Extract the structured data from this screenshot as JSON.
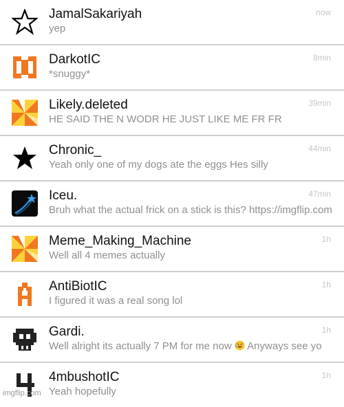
{
  "conversations": [
    {
      "name": "JamalSakariyah",
      "message": "yep",
      "time": "now",
      "avatar_icon": "star-outline-icon"
    },
    {
      "name": "DarkotIC",
      "message": "*snuggy*",
      "time": "8min",
      "avatar_icon": "orange-block-logo-icon",
      "avatar_color": "#f07820"
    },
    {
      "name": "Likely.deleted",
      "message": "HE SAID THE N WODR HE JUST LIKE ME FR FR",
      "time": "39min",
      "avatar_icon": "orange-pinwheel-icon",
      "avatar_color": "#f7a21b"
    },
    {
      "name": "Chronic_",
      "message": "Yeah only one of my dogs ate the eggs Hes silly",
      "time": "44min",
      "avatar_icon": "star-filled-icon"
    },
    {
      "name": "Iceu.",
      "message": "Bruh what the actual frick on a stick is this? https://imgflip.com",
      "time": "47min",
      "avatar_icon": "shooting-star-icon",
      "avatar_color": "#2a8cd4"
    },
    {
      "name": "Meme_Making_Machine",
      "message": "Well all 4 memes actually",
      "time": "1h",
      "avatar_icon": "orange-pinwheel-icon",
      "avatar_color": "#f7a21b"
    },
    {
      "name": "AntiBiotIC",
      "message": "I figured it was a real song lol",
      "time": "1h",
      "avatar_icon": "orange-pixel-a-icon",
      "avatar_color": "#f07820"
    },
    {
      "name": "Gardi.",
      "message": "Well alright its actually 7 PM for me now",
      "message_suffix": " Anyways see yo",
      "time": "1h",
      "avatar_icon": "pixel-skull-icon",
      "emoji_icon": "rofl-emoji-icon"
    },
    {
      "name": "4mbushotIC",
      "message": "Yeah hopefully",
      "time": "1h",
      "avatar_icon": "pixel-four-icon"
    }
  ],
  "watermark": "imgflip.com"
}
